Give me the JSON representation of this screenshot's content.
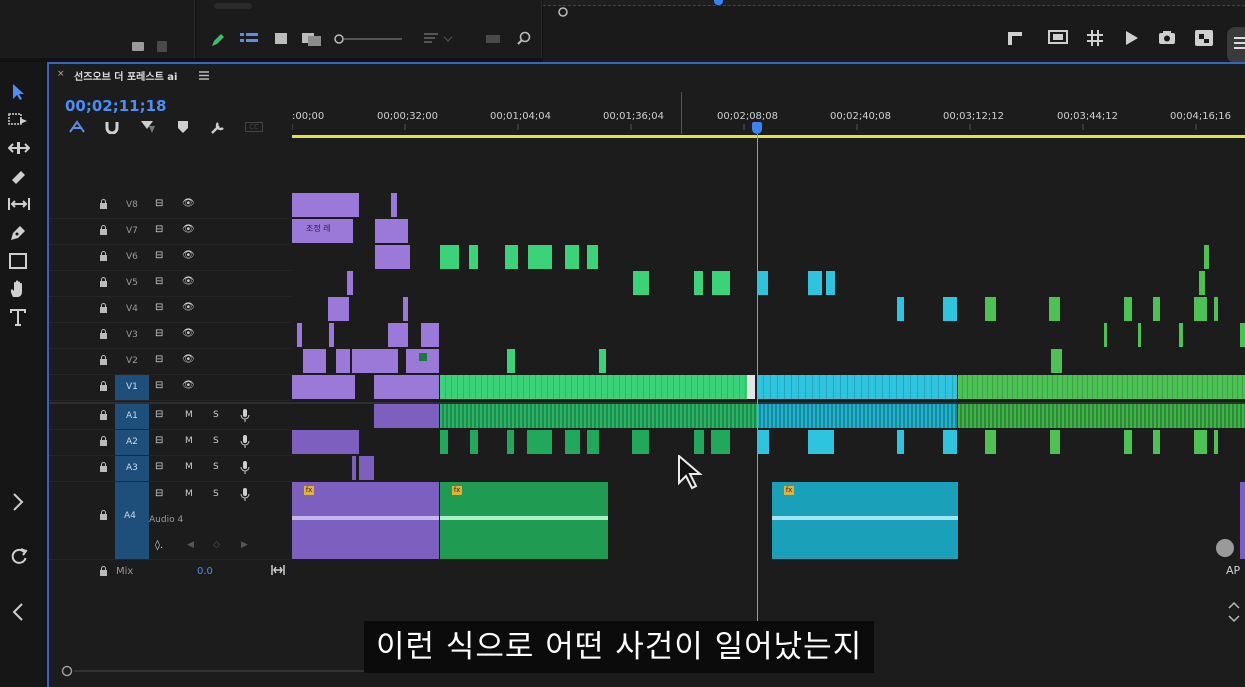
{
  "sequence": {
    "name": "선즈오브 더 포레스트 ai",
    "timecode": "00;02;11;18",
    "mix_label": "Mix",
    "mix_value": "0.0"
  },
  "ruler": {
    "labels": [
      ":00;00",
      "00;00;32;00",
      "00;01;04;04",
      "00;01;36;04",
      "00;02;08;08",
      "00;02;40;08",
      "00;03;12;12",
      "00;03;44;12",
      "00;04;16;16"
    ]
  },
  "video_tracks": [
    "V8",
    "V7",
    "V6",
    "V5",
    "V4",
    "V3",
    "V2",
    "V1"
  ],
  "audio_tracks": [
    "A1",
    "A2",
    "A3",
    "A4"
  ],
  "audio_track_name": "Audio 4",
  "button_letters": {
    "mute": "M",
    "solo": "S"
  },
  "clip_labels": {
    "adjustment": "조정 레"
  },
  "right_label": "AP",
  "subtitle": "이런 식으로 어떤 사건이 일어났는지",
  "colors": {
    "purple": "#9b79d8",
    "green": "#3ad37a",
    "cyan": "#2ec4dd",
    "accent": "#3b63c4",
    "playhead": "#3b82f6"
  }
}
